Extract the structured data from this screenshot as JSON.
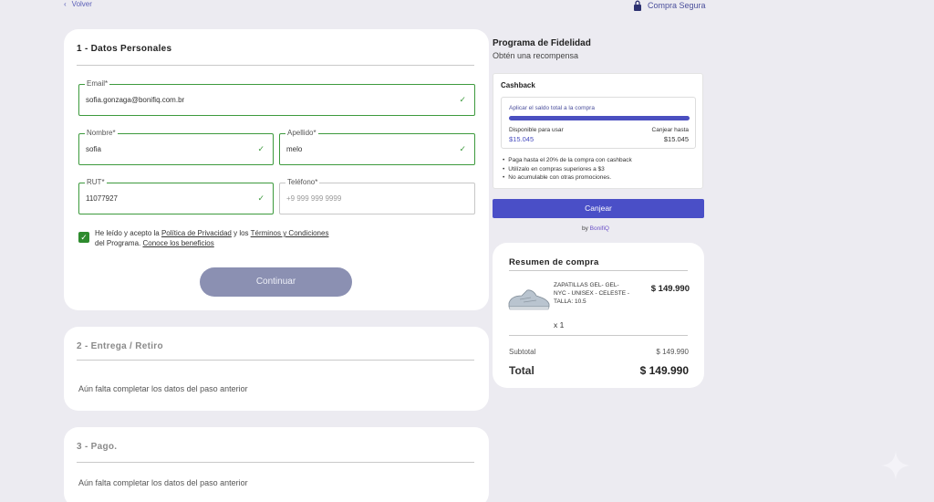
{
  "nav": {
    "back_label": "Volver",
    "secure_label": "Compra Segura"
  },
  "step1": {
    "title": "1 - Datos Personales",
    "email": {
      "label": "Email*",
      "value": "sofia.gonzaga@bonifiq.com.br"
    },
    "nombre": {
      "label": "Nombre*",
      "value": "sofia"
    },
    "apellido": {
      "label": "Apellido*",
      "value": "melo"
    },
    "rut": {
      "label": "RUT*",
      "value": "11077927"
    },
    "telefono": {
      "label": "Teléfono*",
      "placeholder": "+9 999 999 9999"
    },
    "consent": {
      "text1": "He leído y acepto la ",
      "privacy_link": "Política de Privacidad",
      "text2": " y los ",
      "terms_link": "Términos y Condiciones",
      "text3": "del Programa. ",
      "benefits_link": "Conoce los beneficios"
    },
    "continue_label": "Continuar"
  },
  "step2": {
    "title": "2 - Entrega / Retiro",
    "pending": "Aún falta completar los datos del paso anterior"
  },
  "step3": {
    "title": "3 - Pago.",
    "pending": "Aún falta completar los datos del paso anterior"
  },
  "loyalty": {
    "title": "Programa de Fidelidad",
    "subtitle": "Obtén una recompensa",
    "cashback": {
      "title": "Cashback",
      "apply_label": "Aplicar el saldo total a la compra",
      "available_label": "Disponible para usar",
      "available_value": "$15.045",
      "redeem_label": "Canjear hasta",
      "redeem_value": "$15.045",
      "bar_fill_fraction": 1.0,
      "bullets": [
        "Paga hasta el 20% de la compra con cashback",
        "Utilízalo en compras superiores a $3",
        "No acumulable con otras promociones."
      ]
    },
    "redeem_button": "Canjear",
    "by_label": "by ",
    "brand": "BonifiQ"
  },
  "summary": {
    "title": "Resumen de compra",
    "product": {
      "name": "ZAPATILLAS GEL- GEL-NYC - UNISEX - CELESTE - TALLA: 10.5",
      "price": "$ 149.990",
      "qty": "x 1"
    },
    "subtotal_label": "Subtotal",
    "subtotal_value": "$ 149.990",
    "total_label": "Total",
    "total_value": "$ 149.990"
  },
  "colors": {
    "accent": "#4a4fc7",
    "success": "#3d9a3d",
    "button_disabled": "#8b90b2"
  }
}
